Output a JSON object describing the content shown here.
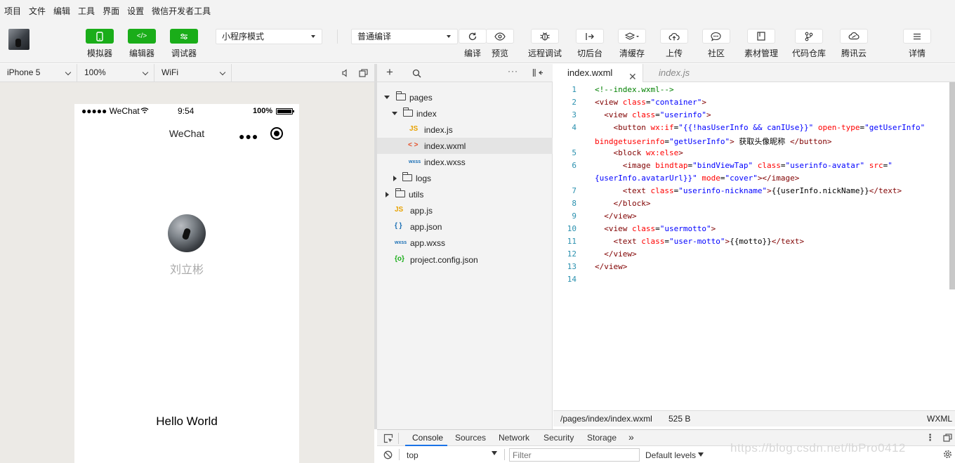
{
  "menu": [
    "项目",
    "文件",
    "编辑",
    "工具",
    "界面",
    "设置",
    "微信开发者工具"
  ],
  "toolbar": {
    "simulator": "模拟器",
    "editor": "编辑器",
    "debugger": "调试器",
    "mode": "小程序模式",
    "compile_mode": "普通编译",
    "compile": "编译",
    "preview": "预览",
    "remote_debug": "远程调试",
    "background": "切后台",
    "clear_cache": "清缓存",
    "upload": "上传",
    "community": "社区",
    "assets": "素材管理",
    "repo": "代码仓库",
    "tencent_cloud": "腾讯云",
    "details": "详情"
  },
  "simulator": {
    "device": "iPhone 5",
    "zoom": "100%",
    "network": "WiFi",
    "status_carrier": "●●●●● WeChat",
    "status_time": "9:54",
    "status_battery": "100%",
    "nav_title": "WeChat",
    "nickname": "刘立彬",
    "motto": "Hello World"
  },
  "filetree": {
    "items": [
      "pages",
      "index",
      "index.js",
      "index.wxml",
      "index.wxss",
      "logs",
      "utils",
      "app.js",
      "app.json",
      "app.wxss",
      "project.config.json"
    ],
    "icons": [
      "JS",
      "< >",
      "wxss",
      "JS",
      "{ }",
      "wxss",
      "{o}"
    ]
  },
  "editor": {
    "active_tab": "index.wxml",
    "other_tab": "index.js",
    "line_numbers": [
      "1",
      "2",
      "3",
      "4",
      "5",
      "6",
      "7",
      "8",
      "9",
      "10",
      "11",
      "12",
      "13",
      "14"
    ]
  },
  "code": {
    "l1": "<!--index.wxml-->",
    "l2_a": "<view ",
    "l2_b": "class",
    "l2_c": "=",
    "l2_d": "\"container\"",
    "l2_e": ">",
    "l3_a": "  <view ",
    "l3_b": "class",
    "l3_c": "=",
    "l3_d": "\"userinfo\"",
    "l3_e": ">",
    "l4_a": "    <button ",
    "l4_b": "wx:if",
    "l4_c": "=",
    "l4_d": "\"{{!hasUserInfo && canIUse}}\"",
    "l4_e": " open-type",
    "l4_f": "=",
    "l4_g": "\"getUserInfo\"",
    "l4w_a": "bindgetuserinfo",
    "l4w_b": "=",
    "l4w_c": "\"getUserInfo\"",
    "l4w_d": ">",
    "l4w_e": " 获取头像昵称 ",
    "l4w_f": "</button>",
    "l5_a": "    <block ",
    "l5_b": "wx:else",
    "l5_c": ">",
    "l6_a": "      <image ",
    "l6_b": "bindtap",
    "l6_c": "=",
    "l6_d": "\"bindViewTap\"",
    "l6_e": " class",
    "l6_f": "=",
    "l6_g": "\"userinfo-avatar\"",
    "l6_h": " src",
    "l6_i": "=",
    "l6_j": "\"",
    "l6w_a": "{userInfo.avatarUrl}}\"",
    "l6w_b": " mode",
    "l6w_c": "=",
    "l6w_d": "\"cover\"",
    "l6w_e": "></image>",
    "l7_a": "      <text ",
    "l7_b": "class",
    "l7_c": "=",
    "l7_d": "\"userinfo-nickname\"",
    "l7_e": ">",
    "l7_f": "{{userInfo.nickName}}",
    "l7_g": "</text>",
    "l8": "    </block>",
    "l9": "  </view>",
    "l10_a": "  <view ",
    "l10_b": "class",
    "l10_c": "=",
    "l10_d": "\"usermotto\"",
    "l10_e": ">",
    "l11_a": "    <text ",
    "l11_b": "class",
    "l11_c": "=",
    "l11_d": "\"user-motto\"",
    "l11_e": ">",
    "l11_f": "{{motto}}",
    "l11_g": "</text>",
    "l12": "  </view>",
    "l13": "</view>"
  },
  "statusbar": {
    "path": "/pages/index/index.wxml",
    "size": "525 B",
    "lang": "WXML"
  },
  "devtools": {
    "tabs": [
      "Console",
      "Sources",
      "Network",
      "Security",
      "Storage"
    ],
    "more": "»",
    "context": "top",
    "filter_placeholder": "Filter",
    "levels": "Default levels"
  },
  "watermark": "https://blog.csdn.net/lbPro0412"
}
